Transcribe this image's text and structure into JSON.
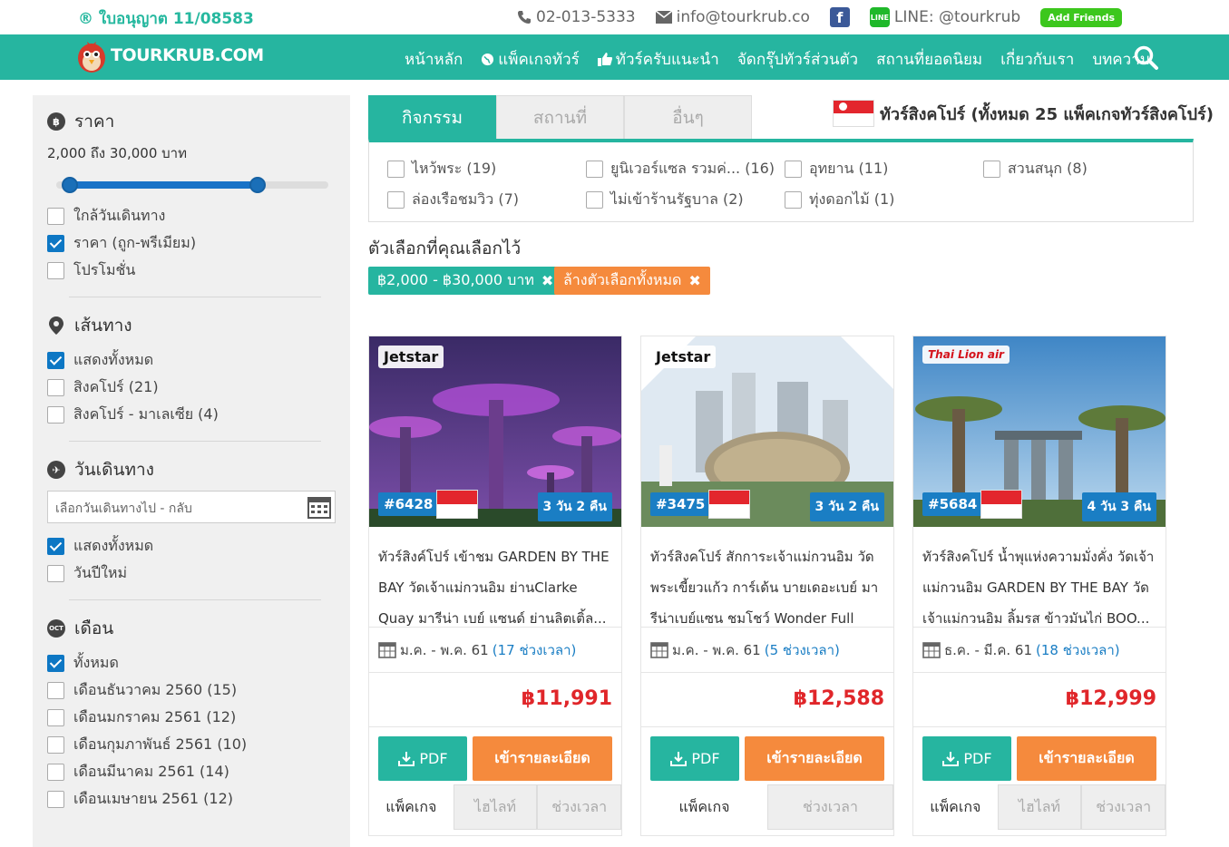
{
  "top": {
    "license": "® ใบอนุญาต 11/08583",
    "phone": "02-013-5333",
    "email": "info@tourkrub.co",
    "line": "LINE: @tourkrub",
    "add_friends": "Add Friends"
  },
  "nav": {
    "logo": "TOURKRUB.COM",
    "items": [
      "หน้าหลัก",
      "แพ็คเกจทัวร์",
      "ทัวร์ครับแนะนำ",
      "จัดกรุ๊ปทัวร์ส่วนตัว",
      "สถานที่ยอดนิยม",
      "เกี่ยวกับเรา",
      "บทความ"
    ]
  },
  "sidebar": {
    "price": {
      "title": "ราคา",
      "range_text": "2,000 ถึง 30,000 บาท",
      "slider_low": 0.05,
      "slider_high": 0.74,
      "options": [
        {
          "label": "ใกล้วันเดินทาง",
          "checked": false
        },
        {
          "label": "ราคา (ถูก-พรีเมียม)",
          "checked": true
        },
        {
          "label": "โปรโมชั่น",
          "checked": false
        }
      ]
    },
    "route": {
      "title": "เส้นทาง",
      "options": [
        {
          "label": "แสดงทั้งหมด",
          "checked": true
        },
        {
          "label": "สิงคโปร์  (21)",
          "checked": false
        },
        {
          "label": "สิงคโปร์ - มาเลเซีย  (4)",
          "checked": false
        }
      ]
    },
    "travel_date": {
      "title": "วันเดินทาง",
      "placeholder": "เลือกวันเดินทางไป - กลับ",
      "options": [
        {
          "label": "แสดงทั้งหมด",
          "checked": true
        },
        {
          "label": "วันปีใหม่",
          "checked": false
        }
      ]
    },
    "month": {
      "title": "เดือน",
      "options": [
        {
          "label": "ทั้งหมด",
          "checked": true
        },
        {
          "label": "เดือนธันวาคม 2560  (15)",
          "checked": false
        },
        {
          "label": "เดือนมกราคม 2561  (12)",
          "checked": false
        },
        {
          "label": "เดือนกุมภาพันธ์ 2561  (10)",
          "checked": false
        },
        {
          "label": "เดือนมีนาคม 2561  (14)",
          "checked": false
        },
        {
          "label": "เดือนเมษายน 2561  (12)",
          "checked": false
        }
      ]
    }
  },
  "main": {
    "tabs": [
      "กิจกรรม",
      "สถานที่",
      "อื่นๆ"
    ],
    "country_title": "ทัวร์สิงคโปร์ (ทั้งหมด 25 แพ็คเกจทัวร์สิงคโปร์)",
    "filters": [
      "ไหว้พระ (19)",
      "ยูนิเวอร์แซล รวมค่... (16)",
      "อุทยาน (11)",
      "สวนสนุก (8)",
      "ล่องเรือชมวิว (7)",
      "ไม่เข้าร้านรัฐบาล (2)",
      "ทุ่งดอกไม้ (1)"
    ],
    "chosen_label": "ตัวเลือกที่คุณเลือกไว้",
    "tag_price": "฿2,000 - ฿30,000 บาท",
    "tag_clear": "ล้างตัวเลือกทั้งหมด"
  },
  "cards": [
    {
      "airline": "Jetstar",
      "code": "#6428",
      "duration": "3 วัน 2 คืน",
      "title": "ทัวร์สิงค์โปร์ เข้าชม GARDEN BY THE BAY วัดเจ้าแม่กวนอิม ย่านClarke Quay มารีน่า เบย์ แซนด์ ย่านลิตเติ้ล...",
      "months": "ม.ค. - พ.ค. 61",
      "slots": "(17 ช่วงเวลา)",
      "price": "฿11,991",
      "pdf": "PDF",
      "detail": "เข้ารายละเอียด",
      "tabs": [
        "แพ็คเกจ",
        "ไฮไลท์",
        "ช่วงเวลา"
      ]
    },
    {
      "airline": "Jetstar",
      "code": "#3475",
      "duration": "3 วัน 2 คืน",
      "title": "ทัวร์สิงคโปร์ สักการะเจ้าแม่กวนอิม วัดพระเขี้ยวแก้ว การ์เด้น บายเดอะเบย์ มารีน่าเบย์แซน ชมโชว์ Wonder Full Lig...",
      "months": "ม.ค. - พ.ค. 61",
      "slots": "(5 ช่วงเวลา)",
      "price": "฿12,588",
      "pdf": "PDF",
      "detail": "เข้ารายละเอียด",
      "tabs": [
        "แพ็คเกจ",
        "ช่วงเวลา"
      ]
    },
    {
      "airline": "Thai Lion air",
      "code": "#5684",
      "duration": "4 วัน 3 คืน",
      "title": "ทัวร์สิงคโปร์ น้ำพุแห่งความมั่งคั่ง วัดเจ้าแม่กวนอิม GARDEN BY THE BAY วัดเจ้าแม่กวนอิม ลิ้มรส ข้าวมันไก่ BOO...",
      "months": "ธ.ค. - มี.ค. 61",
      "slots": "(18 ช่วงเวลา)",
      "price": "฿12,999",
      "pdf": "PDF",
      "detail": "เข้ารายละเอียด",
      "tabs": [
        "แพ็คเกจ",
        "ไฮไลท์",
        "ช่วงเวลา"
      ]
    }
  ]
}
